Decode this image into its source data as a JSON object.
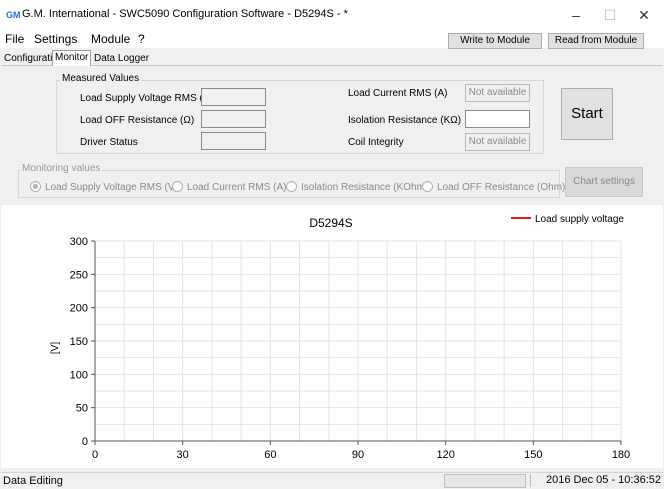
{
  "window": {
    "icon_text": "GM",
    "title": "G.M. International - SWC5090 Configuration Software - D5294S - *",
    "controls": {
      "minimize": "–",
      "maximize": "☐",
      "close": "✕"
    }
  },
  "menu": {
    "items": [
      "File",
      "Settings",
      "Module",
      "?"
    ]
  },
  "toolbar": {
    "write_label": "Write to Module",
    "read_label": "Read from Module"
  },
  "tabs": [
    "Configuration",
    "Monitor",
    "Data Logger"
  ],
  "active_tab": "Monitor",
  "measured": {
    "group_label": "Measured Values",
    "load_supply_voltage": {
      "label": "Load Supply Voltage RMS (V)",
      "value": ""
    },
    "load_off_resistance": {
      "label": "Load OFF Resistance (Ω)",
      "value": ""
    },
    "driver_status": {
      "label": "Driver Status",
      "value": ""
    },
    "load_current": {
      "label": "Load Current RMS (A)",
      "value": "Not available"
    },
    "isolation_resistance": {
      "label": "Isolation Resistance (KΩ)",
      "value": ""
    },
    "coil_integrity": {
      "label": "Coil Integrity",
      "value": "Not available"
    }
  },
  "start_label": "Start",
  "monitoring": {
    "group_label": "Monitoring values",
    "options": [
      "Load Supply Voltage RMS (V)",
      "Load Current RMS (A)",
      "Isolation Resistance (KOhm)",
      "Load OFF Resistance (Ohm)"
    ],
    "selected": 0
  },
  "chart_settings_label": "Chart settings",
  "chart_data": {
    "type": "line",
    "title": "D5294S",
    "ylabel": "[V]",
    "xlabel": "",
    "xlim": [
      0,
      180
    ],
    "ylim": [
      0,
      300
    ],
    "x_ticks": [
      0,
      30,
      60,
      90,
      120,
      150,
      180
    ],
    "y_ticks": [
      0,
      50,
      100,
      150,
      200,
      250,
      300
    ],
    "grid": true,
    "legend_position": "top-right",
    "series": [
      {
        "name": "Load supply voltage",
        "color": "#e02020",
        "x": [],
        "y": []
      }
    ]
  },
  "status": {
    "left_text": "Data Editing",
    "datetime": "2016 Dec 05 - 10:36:52"
  }
}
